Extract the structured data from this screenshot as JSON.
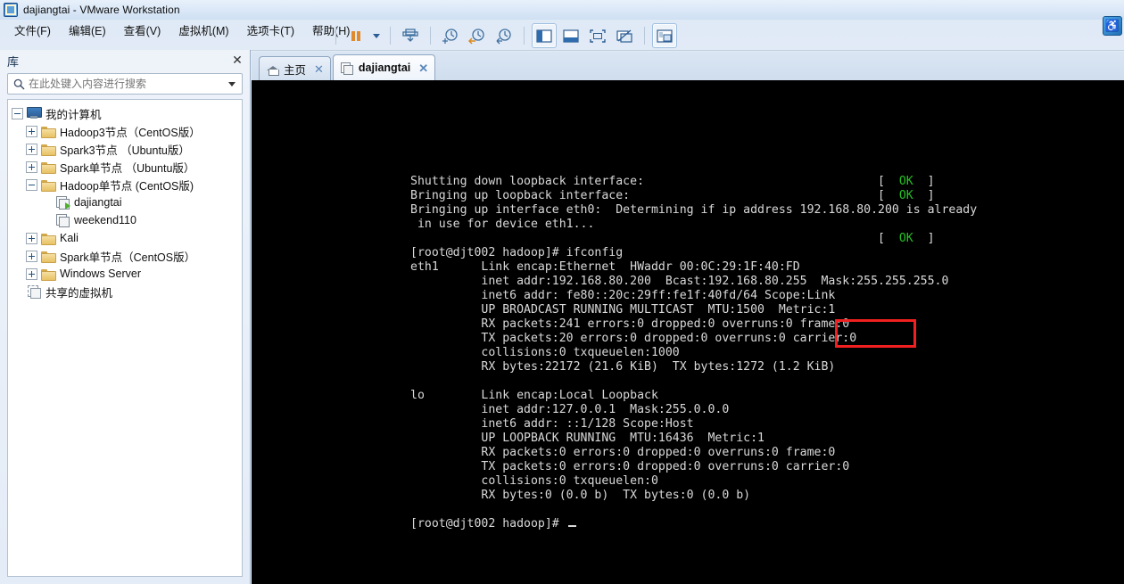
{
  "window": {
    "title": "dajiangtai - VMware Workstation",
    "app_icon": "vmware-icon",
    "corner_icon": "updates-icon",
    "corner_glyph": "♿"
  },
  "menubar": [
    {
      "label": "文件(F)",
      "name": "menu-file"
    },
    {
      "label": "编辑(E)",
      "name": "menu-edit"
    },
    {
      "label": "查看(V)",
      "name": "menu-view"
    },
    {
      "label": "虚拟机(M)",
      "name": "menu-vm"
    },
    {
      "label": "选项卡(T)",
      "name": "menu-tabs"
    },
    {
      "label": "帮助(H)",
      "name": "menu-help"
    }
  ],
  "toolbar": {
    "items": [
      {
        "name": "suspend-button",
        "icon": "pause-icon"
      },
      {
        "name": "suspend-dropdown",
        "icon": "chevron-down-icon"
      },
      {
        "name": "power-button",
        "icon": "power-icon"
      },
      {
        "name": "snapshot-take-button",
        "icon": "snapshot-add-icon"
      },
      {
        "name": "snapshot-revert-button",
        "icon": "snapshot-revert-icon"
      },
      {
        "name": "snapshot-manager-button",
        "icon": "snapshot-manager-icon"
      },
      {
        "name": "show-library-button",
        "icon": "library-panel-icon"
      },
      {
        "name": "show-thumbnail-bar-button",
        "icon": "thumbnail-bar-icon"
      },
      {
        "name": "fullscreen-button",
        "icon": "fullscreen-icon"
      },
      {
        "name": "unity-mode-button",
        "icon": "unity-mode-icon"
      },
      {
        "name": "console-view-button",
        "icon": "console-view-icon"
      }
    ]
  },
  "library": {
    "title": "库",
    "close_label": "✕",
    "search": {
      "placeholder": "在此处键入内容进行搜索",
      "value": "",
      "icon": "search-icon"
    },
    "tree": [
      {
        "label": "我的计算机",
        "icon": "computer-icon",
        "indent": 0,
        "twisty": "minus",
        "name": "tree-item-my-computer"
      },
      {
        "label": "Hadoop3节点（CentOS版）",
        "icon": "folder-icon",
        "indent": 1,
        "twisty": "plus",
        "name": "tree-item-hadoop3-centos"
      },
      {
        "label": "Spark3节点    （Ubuntu版）",
        "icon": "folder-icon",
        "indent": 1,
        "twisty": "plus",
        "name": "tree-item-spark3-ubuntu"
      },
      {
        "label": "Spark单节点    （Ubuntu版）",
        "icon": "folder-icon",
        "indent": 1,
        "twisty": "plus",
        "name": "tree-item-spark-single-ubuntu"
      },
      {
        "label": "Hadoop单节点 (CentOS版)",
        "icon": "folder-icon",
        "indent": 1,
        "twisty": "minus",
        "name": "tree-item-hadoop-single-centos"
      },
      {
        "label": "dajiangtai",
        "icon": "vm-running-icon",
        "indent": 2,
        "twisty": "none",
        "name": "tree-item-dajiangtai"
      },
      {
        "label": "weekend110",
        "icon": "vm-icon",
        "indent": 2,
        "twisty": "none",
        "name": "tree-item-weekend110"
      },
      {
        "label": "Kali",
        "icon": "folder-icon",
        "indent": 1,
        "twisty": "plus",
        "name": "tree-item-kali"
      },
      {
        "label": "Spark单节点（CentOS版）",
        "icon": "folder-icon",
        "indent": 1,
        "twisty": "plus",
        "name": "tree-item-spark-single-centos"
      },
      {
        "label": "Windows Server",
        "icon": "folder-icon",
        "indent": 1,
        "twisty": "plus",
        "name": "tree-item-windows-server"
      },
      {
        "label": "共享的虚拟机",
        "icon": "shared-vm-icon",
        "indent": 0,
        "twisty": "none",
        "name": "tree-item-shared-vms"
      }
    ]
  },
  "tabs": [
    {
      "label": "主页",
      "icon": "home-icon",
      "active": false,
      "close": "✕",
      "name": "tab-home"
    },
    {
      "label": "dajiangtai",
      "icon": "vm-icon",
      "active": true,
      "close": "✕",
      "name": "tab-dajiangtai"
    }
  ],
  "terminal": {
    "highlight": {
      "text": "ifconfig",
      "color": "#f02020"
    },
    "lines": [
      {
        "text": "Shutting down loopback interface:",
        "status": "OK",
        "status_col": 66
      },
      {
        "text": "Bringing up loopback interface:",
        "status": "OK",
        "status_col": 66
      },
      {
        "text": "Bringing up interface eth0:  Determining if ip address 192.168.80.200 is already",
        "status": "",
        "status_col": 0
      },
      {
        "text": " in use for device eth1...",
        "status": "",
        "status_col": 0
      },
      {
        "text": "",
        "status": "OK",
        "status_col": 66
      },
      {
        "text": "[root@djt002 hadoop]# ifconfig",
        "status": "",
        "status_col": 0
      },
      {
        "text": "eth1      Link encap:Ethernet  HWaddr 00:0C:29:1F:40:FD",
        "status": "",
        "status_col": 0
      },
      {
        "text": "          inet addr:192.168.80.200  Bcast:192.168.80.255  Mask:255.255.255.0",
        "status": "",
        "status_col": 0
      },
      {
        "text": "          inet6 addr: fe80::20c:29ff:fe1f:40fd/64 Scope:Link",
        "status": "",
        "status_col": 0
      },
      {
        "text": "          UP BROADCAST RUNNING MULTICAST  MTU:1500  Metric:1",
        "status": "",
        "status_col": 0
      },
      {
        "text": "          RX packets:241 errors:0 dropped:0 overruns:0 frame:0",
        "status": "",
        "status_col": 0
      },
      {
        "text": "          TX packets:20 errors:0 dropped:0 overruns:0 carrier:0",
        "status": "",
        "status_col": 0
      },
      {
        "text": "          collisions:0 txqueuelen:1000",
        "status": "",
        "status_col": 0
      },
      {
        "text": "          RX bytes:22172 (21.6 KiB)  TX bytes:1272 (1.2 KiB)",
        "status": "",
        "status_col": 0
      },
      {
        "text": "",
        "status": "",
        "status_col": 0
      },
      {
        "text": "lo        Link encap:Local Loopback",
        "status": "",
        "status_col": 0
      },
      {
        "text": "          inet addr:127.0.0.1  Mask:255.0.0.0",
        "status": "",
        "status_col": 0
      },
      {
        "text": "          inet6 addr: ::1/128 Scope:Host",
        "status": "",
        "status_col": 0
      },
      {
        "text": "          UP LOOPBACK RUNNING  MTU:16436  Metric:1",
        "status": "",
        "status_col": 0
      },
      {
        "text": "          RX packets:0 errors:0 dropped:0 overruns:0 frame:0",
        "status": "",
        "status_col": 0
      },
      {
        "text": "          TX packets:0 errors:0 dropped:0 overruns:0 carrier:0",
        "status": "",
        "status_col": 0
      },
      {
        "text": "          collisions:0 txqueuelen:0",
        "status": "",
        "status_col": 0
      },
      {
        "text": "          RX bytes:0 (0.0 b)  TX bytes:0 (0.0 b)",
        "status": "",
        "status_col": 0
      },
      {
        "text": "",
        "status": "",
        "status_col": 0
      },
      {
        "text": "[root@djt002 hadoop]# ",
        "status": "",
        "status_col": 0,
        "cursor": true
      }
    ]
  }
}
